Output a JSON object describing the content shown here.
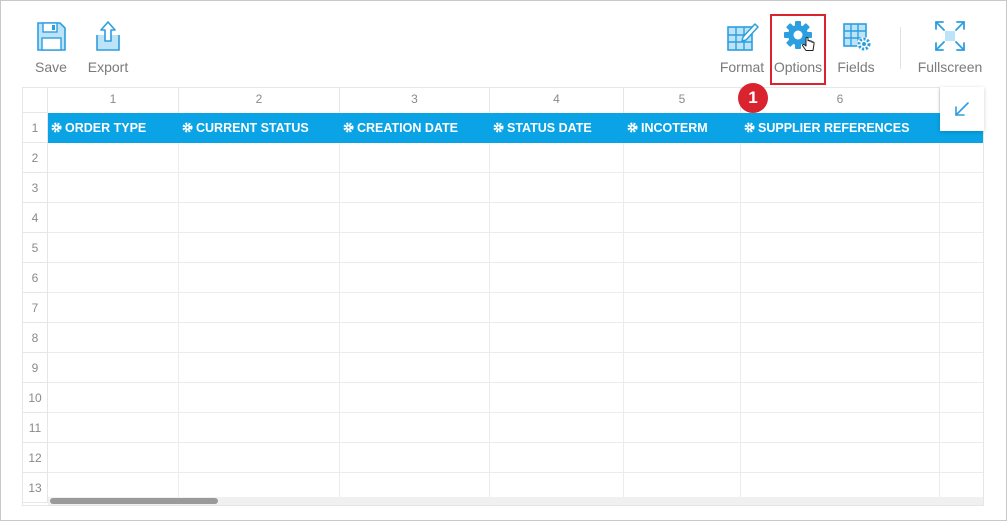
{
  "toolbar": {
    "save": {
      "label": "Save",
      "icon": "floppy-disk-icon"
    },
    "export": {
      "label": "Export",
      "icon": "upload-arrow-icon"
    },
    "format": {
      "label": "Format",
      "icon": "table-pencil-icon"
    },
    "options": {
      "label": "Options",
      "icon": "gear-icon"
    },
    "fields": {
      "label": "Fields",
      "icon": "table-gear-icon"
    },
    "fullscreen": {
      "label": "Fullscreen",
      "icon": "expand-arrows-icon"
    }
  },
  "callout": {
    "number": "1",
    "color": "#d9232e"
  },
  "colors": {
    "accent": "#0aa3e6",
    "icon_fill": "#bde3f8",
    "icon_stroke": "#2c9fe0"
  },
  "grid": {
    "column_numbers": [
      "1",
      "2",
      "3",
      "4",
      "5",
      "6"
    ],
    "row_numbers": [
      "1",
      "2",
      "3",
      "4",
      "5",
      "6",
      "7",
      "8",
      "9",
      "10",
      "11",
      "12",
      "13"
    ],
    "header_fields": [
      "ORDER TYPE",
      "CURRENT STATUS",
      "CREATION DATE",
      "STATUS DATE",
      "INCOTERM",
      "SUPPLIER REFERENCES"
    ]
  }
}
